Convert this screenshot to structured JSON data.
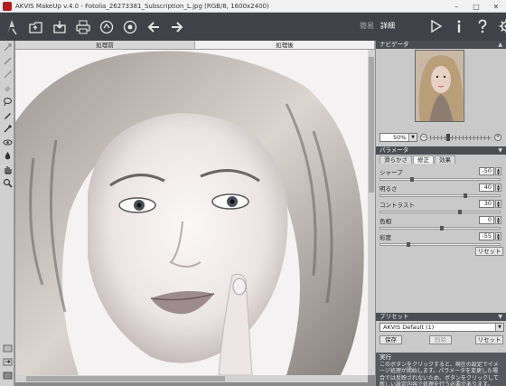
{
  "window": {
    "title": "AKVIS MakeUp v.4.0 - Fotolia_26273381_Subscription_L.jpg (RGB/8, 1600x2400)",
    "controls": [
      "minimize",
      "maximize",
      "close"
    ]
  },
  "toolbar": {
    "left_icons": [
      "open-file-icon",
      "save-icon",
      "print-icon",
      "share-icon",
      "batch-icon",
      "undo-icon",
      "redo-icon"
    ],
    "mode_simple": "簡易",
    "mode_advanced": "詳細",
    "right_icons": [
      "run-icon",
      "info-icon",
      "help-icon",
      "settings-icon"
    ]
  },
  "canvas": {
    "tab_before": "処理前",
    "tab_after": "処理後",
    "active_tab": "after"
  },
  "navigator": {
    "title": "ナビゲータ",
    "zoom": "50%",
    "zoom_minus": "−",
    "zoom_plus": "+"
  },
  "parameters": {
    "title": "パラメータ",
    "tabs": [
      "滑らかさ",
      "修正",
      "効果"
    ],
    "active_tab": 1,
    "items": [
      {
        "label": "シャープ",
        "value": "-50",
        "level": 0.25
      },
      {
        "label": "明るさ",
        "value": "40",
        "level": 0.7
      },
      {
        "label": "コントラスト",
        "value": "30",
        "level": 0.65
      },
      {
        "label": "色相",
        "value": "0",
        "level": 0.5
      },
      {
        "label": "彩度",
        "value": "-55",
        "level": 0.22
      }
    ],
    "reset_label": "リセット"
  },
  "presets": {
    "title": "プリセット",
    "selected": "AKVIS Default (1)",
    "save_label": "保存",
    "delete_label": "削除",
    "reset_label": "リセット"
  },
  "hint": {
    "title": "実行",
    "text": "このボタンをクリックすると、現在の設定でイメージ処理が開始します。パラメータを変更した場合では反映されないため、ボタンをクリックして新しい設定内容で処理を行う必要があります。"
  },
  "colors": {
    "toolbar_bg": "#3f4347",
    "panel_header_bg": "#4a4e52",
    "panel_bg": "#c9c9c9",
    "brand": "#b01e1e"
  }
}
